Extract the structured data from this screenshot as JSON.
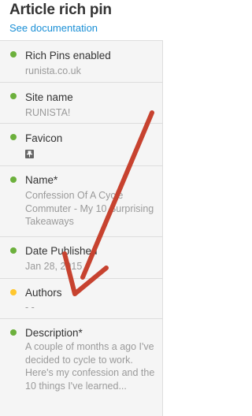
{
  "header": {
    "title": "Article rich pin",
    "doc_link": "See documentation"
  },
  "colors": {
    "ok": "#6cb03c",
    "warn": "#ffc72e",
    "link": "#1a8fd6",
    "annotation_arrow": "#c7422f"
  },
  "fields": [
    {
      "label": "Rich Pins enabled",
      "value": "runista.co.uk",
      "status": "ok"
    },
    {
      "label": "Site name",
      "value": "RUNISTA!",
      "status": "ok"
    },
    {
      "label": "Favicon",
      "value": "",
      "icon": "pin-favicon-icon",
      "status": "ok"
    },
    {
      "label": "Name*",
      "value": "Confession Of A Cycle Commuter - My 10 Surprising Takeaways",
      "status": "ok"
    },
    {
      "label": "Date Published",
      "value": "Jan 28, 2015",
      "status": "ok"
    },
    {
      "label": "Authors",
      "value": "- -",
      "status": "warning"
    },
    {
      "label": "Description*",
      "value": "A couple of months a ago I've decided to cycle to work. Here's my confession and the 10 things I've learned...",
      "status": "ok"
    }
  ]
}
